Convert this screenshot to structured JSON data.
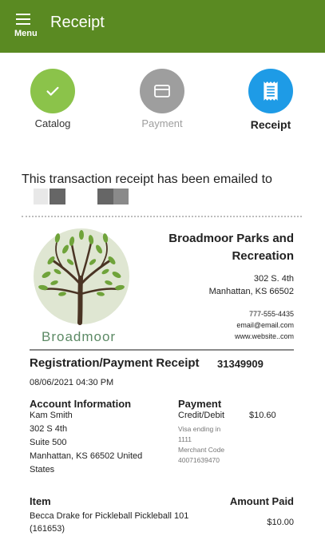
{
  "appbar": {
    "menu_label": "Menu",
    "title": "Receipt",
    "color": "#5a8a22"
  },
  "steps": [
    {
      "label": "Catalog",
      "icon": "check-icon",
      "color": "#8bc34a",
      "state": "complete"
    },
    {
      "label": "Payment",
      "icon": "credit-card-icon",
      "color": "#9e9e9e",
      "state": "inactive"
    },
    {
      "label": "Receipt",
      "icon": "receipt-icon",
      "color": "#1e9be6",
      "state": "active"
    }
  ],
  "emailed_message": "This transaction receipt has been emailed to",
  "organization": {
    "logo_text": "Broadmoor",
    "name": "Broadmoor Parks and Recreation",
    "address_line1": "302 S. 4th",
    "address_line2": "Manhattan, KS 66502",
    "phone": "777-555-4435",
    "email": "email@email.com",
    "website": "www.website..com"
  },
  "receipt": {
    "title": "Registration/Payment Receipt",
    "number": "31349909",
    "date": "08/06/2021 04:30 PM"
  },
  "account": {
    "heading": "Account Information",
    "name": "Kam Smith",
    "street": "302 S 4th",
    "suite": "Suite 500",
    "city_line": "Manhattan, KS 66502 United",
    "country": "States"
  },
  "payment": {
    "heading": "Payment",
    "method": "Credit/Debit",
    "amount": "$10.60",
    "card_line1": "Visa ending in",
    "card_line2": "1111",
    "merchant_line1": "Merchant Code",
    "merchant_line2": "40071639470"
  },
  "items": {
    "item_heading": "Item",
    "amount_heading": "Amount Paid",
    "rows": [
      {
        "line1": "Becca Drake for Pickleball Pickleball 101",
        "line2": "(161653)",
        "amount": "$10.00"
      }
    ]
  }
}
